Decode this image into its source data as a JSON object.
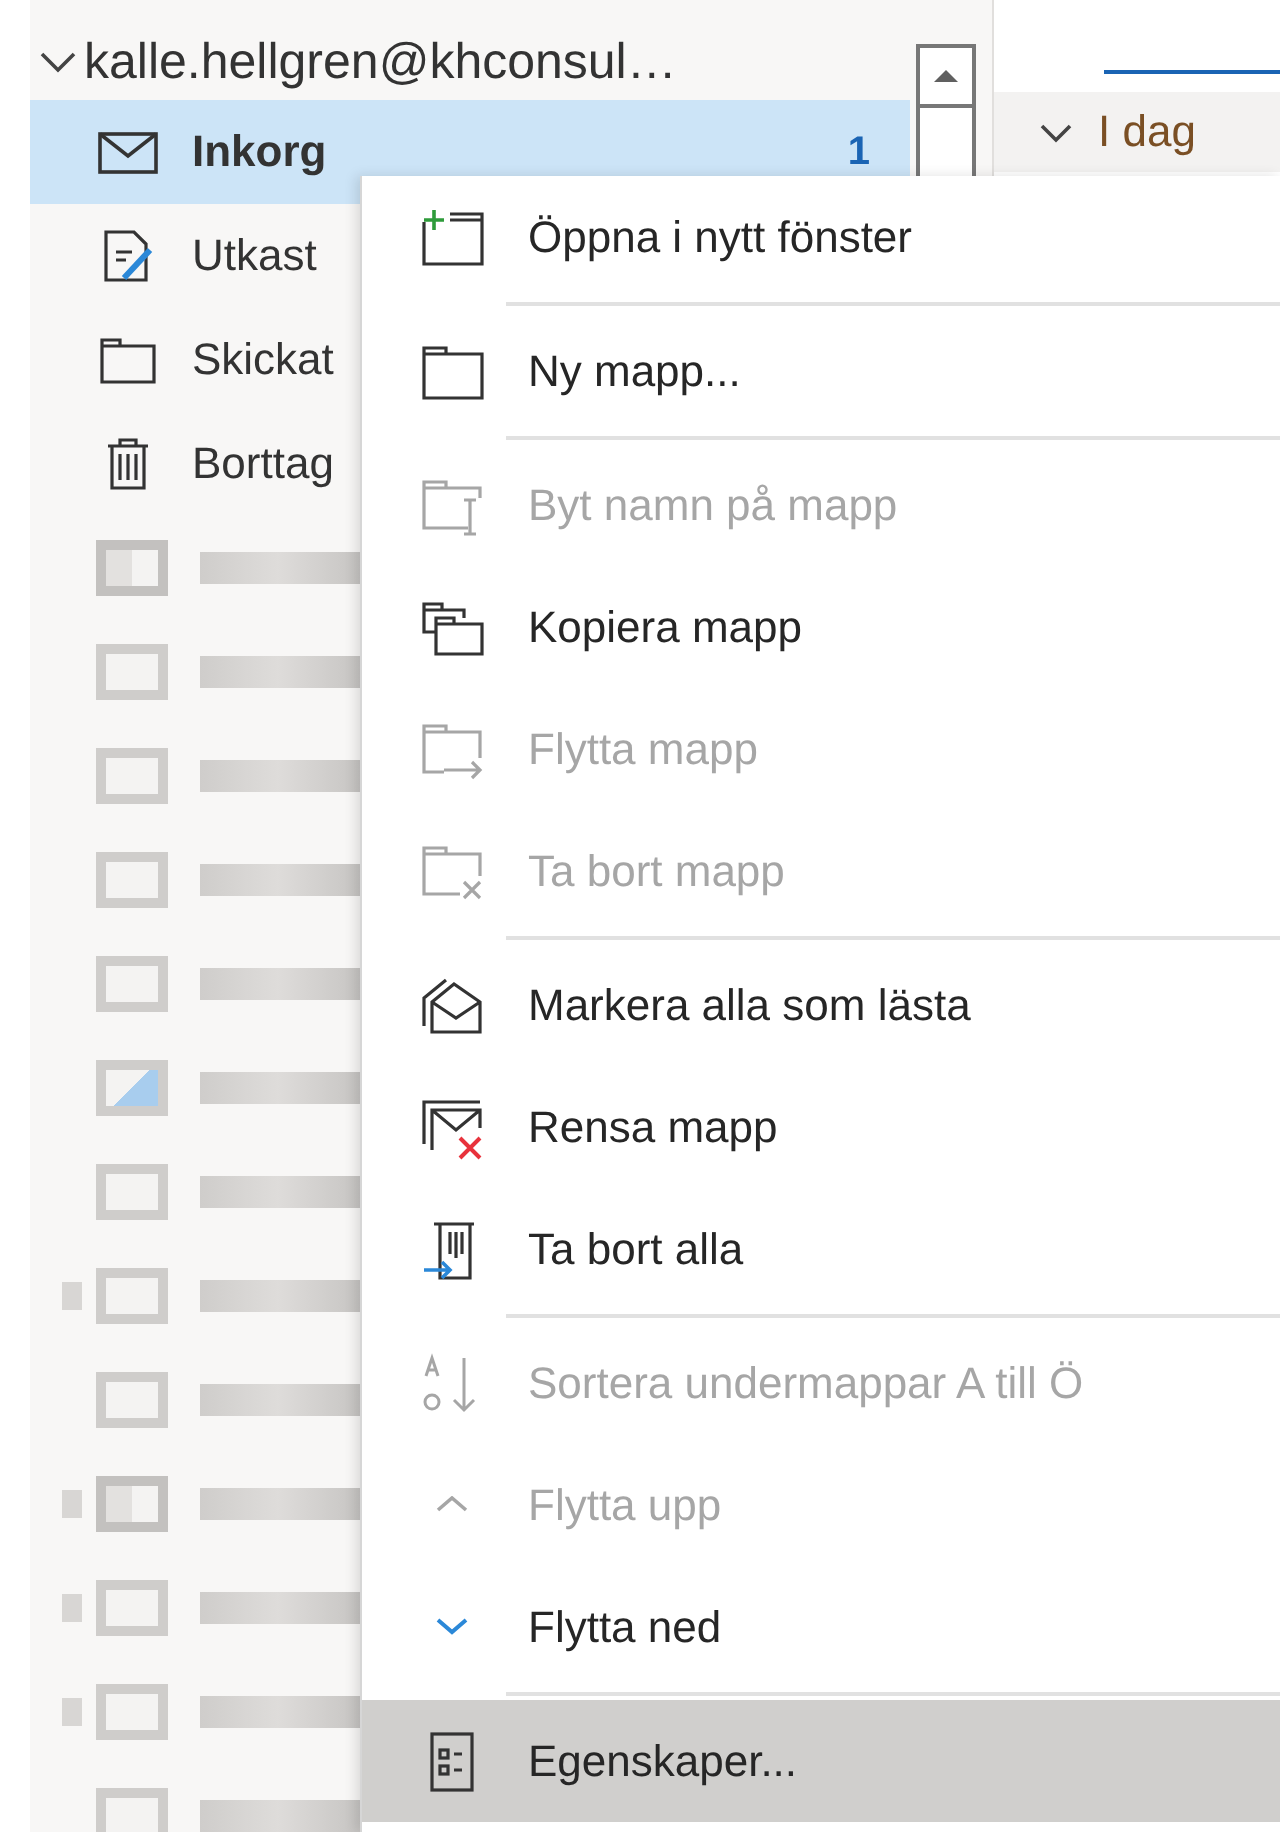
{
  "account": {
    "label": "kalle.hellgren@khconsul…",
    "expanded": true
  },
  "folders": [
    {
      "label": "Inkorg",
      "kind": "inbox",
      "count": "1",
      "selected": true
    },
    {
      "label": "Utkast",
      "kind": "drafts",
      "selected": false
    },
    {
      "label": "Skickat",
      "kind": "folder",
      "selected": false
    },
    {
      "label": "Borttag",
      "kind": "trash",
      "selected": false
    }
  ],
  "blurred_folders": [
    {
      "kind": "special",
      "expandable": false
    },
    {
      "kind": "folder",
      "expandable": false
    },
    {
      "kind": "folder",
      "expandable": false
    },
    {
      "kind": "folder",
      "expandable": false
    },
    {
      "kind": "folder",
      "expandable": false
    },
    {
      "kind": "shared",
      "expandable": false
    },
    {
      "kind": "folder",
      "expandable": false
    },
    {
      "kind": "folder",
      "expandable": true
    },
    {
      "kind": "folder",
      "expandable": false
    },
    {
      "kind": "special",
      "expandable": true
    },
    {
      "kind": "folder",
      "expandable": true
    },
    {
      "kind": "folder",
      "expandable": true
    },
    {
      "kind": "folder",
      "expandable": false
    }
  ],
  "message_list": {
    "group": {
      "label": "I dag",
      "expanded": true
    }
  },
  "context_menu": [
    {
      "label": "Öppna i nytt fönster",
      "kind": "new-window",
      "disabled": false,
      "selected": false,
      "separator_after": true
    },
    {
      "label": "Ny mapp...",
      "kind": "folder",
      "disabled": false,
      "selected": false,
      "separator_after": true
    },
    {
      "label": "Byt namn på mapp",
      "kind": "rename",
      "disabled": true,
      "selected": false,
      "separator_after": false
    },
    {
      "label": "Kopiera mapp",
      "kind": "copy",
      "disabled": false,
      "selected": false,
      "separator_after": false
    },
    {
      "label": "Flytta mapp",
      "kind": "move",
      "disabled": true,
      "selected": false,
      "separator_after": false
    },
    {
      "label": "Ta bort mapp",
      "kind": "delete-folder",
      "disabled": true,
      "selected": false,
      "separator_after": true
    },
    {
      "label": "Markera alla som lästa",
      "kind": "mark-read",
      "disabled": false,
      "selected": false,
      "separator_after": false
    },
    {
      "label": "Rensa mapp",
      "kind": "clean",
      "disabled": false,
      "selected": false,
      "separator_after": false
    },
    {
      "label": "Ta bort alla",
      "kind": "delete-all",
      "disabled": false,
      "selected": false,
      "separator_after": true
    },
    {
      "label": "Sortera undermappar A till Ö",
      "kind": "sort",
      "disabled": true,
      "selected": false,
      "separator_after": false
    },
    {
      "label": "Flytta upp",
      "kind": "up",
      "disabled": true,
      "selected": false,
      "separator_after": false
    },
    {
      "label": "Flytta ned",
      "kind": "down",
      "disabled": false,
      "selected": false,
      "separator_after": true
    },
    {
      "label": "Egenskaper...",
      "kind": "properties",
      "disabled": false,
      "selected": true,
      "separator_after": false
    }
  ]
}
